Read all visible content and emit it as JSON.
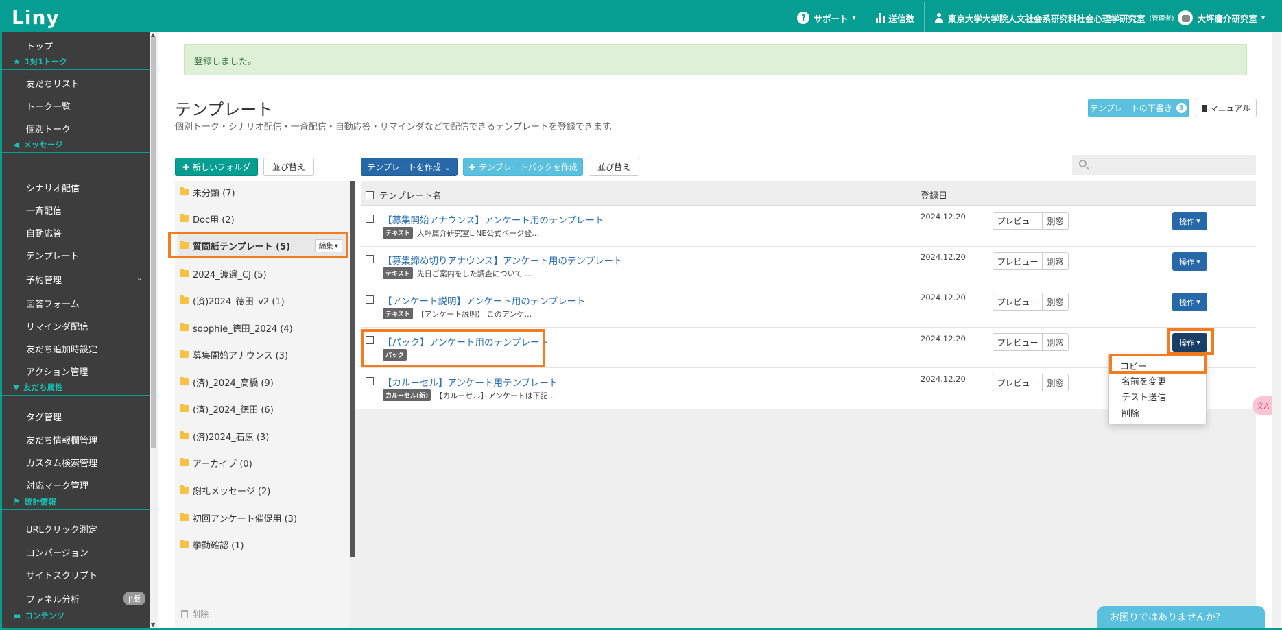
{
  "header": {
    "logo": "Liny",
    "support_label": "サポート",
    "send_count_label": "送信数",
    "account_label": "東京大学大学院人文社会系研究科社会心理学研究室",
    "account_role": "(管理者)",
    "lab_label": "大坪庸介研究室"
  },
  "sidebar": {
    "top": "トップ",
    "sec_talk": "1対1トーク",
    "friends_list": "友だちリスト",
    "talk_list": "トーク一覧",
    "individual_talk": "個別トーク",
    "sec_message": "メッセージ",
    "scenario": "シナリオ配信",
    "broadcast": "一斉配信",
    "auto_reply": "自動応答",
    "template": "テンプレート",
    "reservation": "予約管理",
    "answer_form": "回答フォーム",
    "reminder": "リマインダ配信",
    "friend_add": "友だち追加時設定",
    "action": "アクション管理",
    "sec_attr": "友だち属性",
    "tag_mgmt": "タグ管理",
    "friend_info": "友だち情報欄管理",
    "custom_search": "カスタム検索管理",
    "mark_mgmt": "対応マーク管理",
    "sec_stats": "統計情報",
    "url_click": "URLクリック測定",
    "conversion": "コンバージョン",
    "site_script": "サイトスクリプト",
    "funnel": "ファネル分析",
    "funnel_badge": "β版",
    "sec_content": "コンテンツ"
  },
  "alert": "登録しました。",
  "page": {
    "title": "テンプレート",
    "subtitle": "個別トーク・シナリオ配信・一斉配信・自動応答・リマインダなどで配信できるテンプレートを登録できます。",
    "draft_btn": "テンプレートの下書き",
    "draft_count": "3",
    "manual_btn": "マニュアル"
  },
  "toolbar": {
    "new_folder": "新しいフォルダ",
    "sort_folders": "並び替え",
    "create_template": "テンプレートを作成",
    "create_pack": "テンプレートパックを作成",
    "sort_templates": "並び替え"
  },
  "folders": [
    "未分類 (7)",
    "Doc用 (2)",
    "質問紙テンプレート (5)",
    "2024_渡邊_CJ (5)",
    "(済)2024_徳田_v2 (1)",
    "sopphie_徳田_2024 (4)",
    "募集開始アナウンス (3)",
    "(済)_2024_高橋 (9)",
    "(済)_2024_徳田 (6)",
    "(済)2024_石原 (3)",
    "アーカイブ (0)",
    "謝礼メッセージ (2)",
    "初回アンケート催促用 (3)",
    "挙動確認 (1)"
  ],
  "folder_edit": "編集",
  "trash_label": "削除",
  "table": {
    "col_name": "テンプレート名",
    "col_date": "登録日",
    "preview": "プレビュー",
    "popup": "別窓",
    "operate": "操作",
    "rows": [
      {
        "title": "【募集開始アナウンス】アンケート用のテンプレート",
        "tag": "テキスト",
        "desc": "大坪庸介研究室LINE公式ページ登…",
        "date": "2024.12.20"
      },
      {
        "title": "【募集締め切りアナウンス】アンケート用のテンプレート",
        "tag": "テキスト",
        "desc": "先日ご案内をした調査について …",
        "date": "2024.12.20"
      },
      {
        "title": "【アンケート説明】アンケート用のテンプレート",
        "tag": "テキスト",
        "desc": "【アンケート説明】 このアンケ…",
        "date": "2024.12.20"
      },
      {
        "title": "【パック】アンケート用のテンプレート",
        "tag": "パック",
        "desc": "",
        "date": "2024.12.20"
      },
      {
        "title": "【カルーセル】アンケート用テンプレート",
        "tag": "カルーセル(新)",
        "desc": "【カルーセル】アンケートは下記…",
        "date": "2024.12.20"
      }
    ]
  },
  "dropdown": {
    "copy": "コピー",
    "rename": "名前を変更",
    "test_send": "テスト送信",
    "delete": "削除"
  },
  "help": "お困りではありませんか？",
  "colors": {
    "brand": "#069e92",
    "link": "#2a6fb2",
    "highlight": "#f47c20",
    "sidebar": "#3d3d3d"
  }
}
